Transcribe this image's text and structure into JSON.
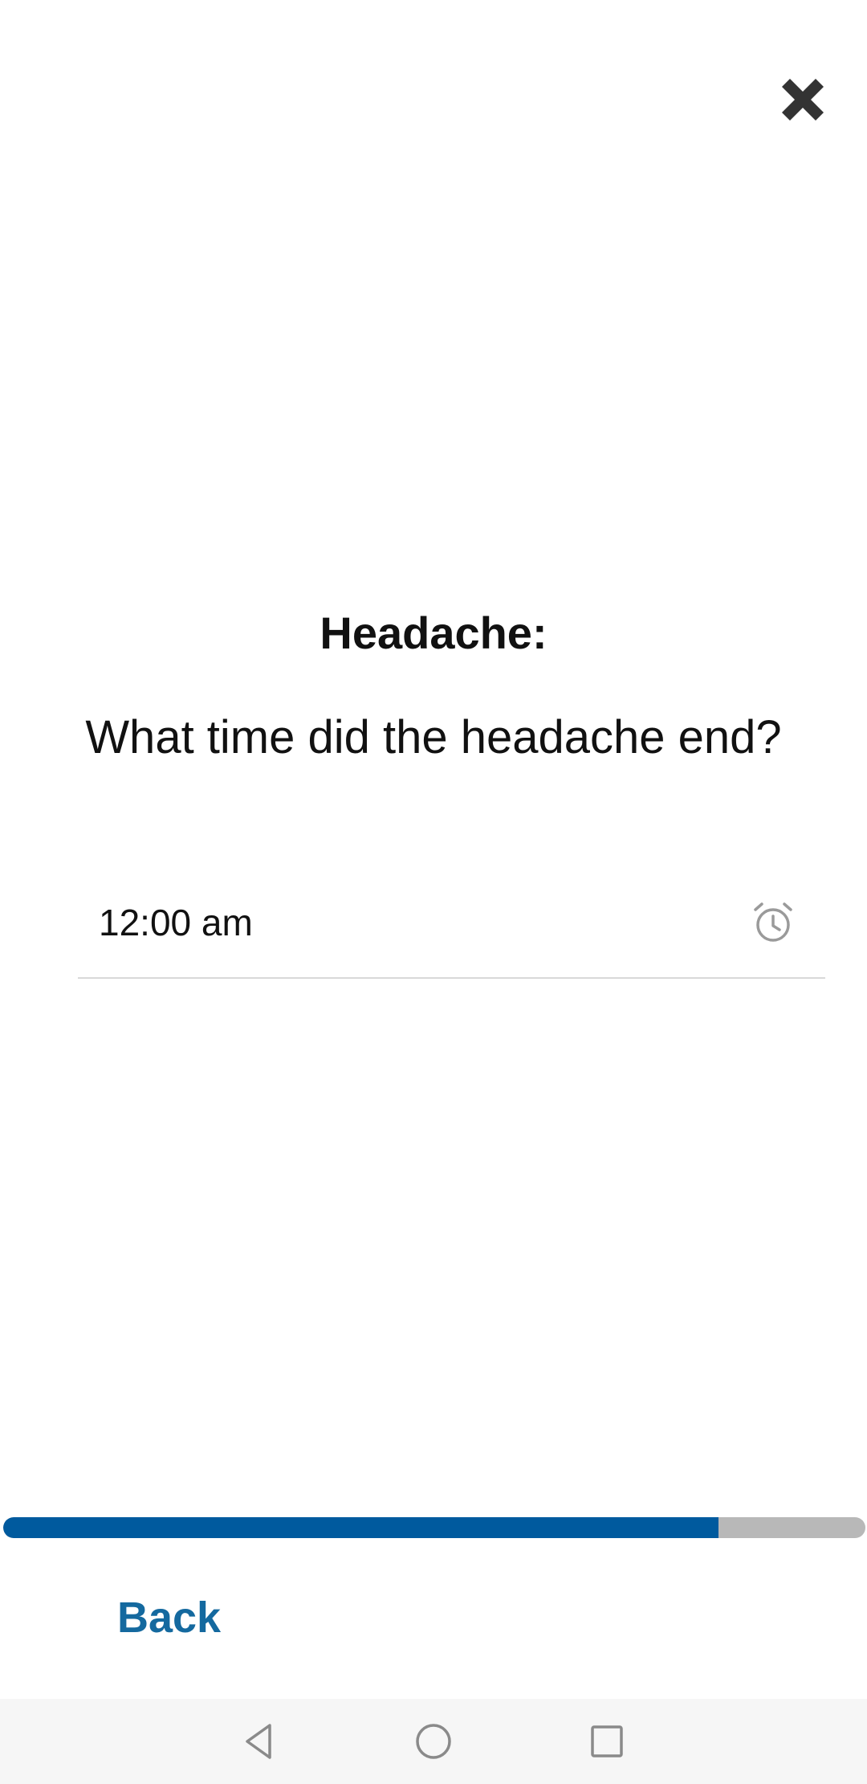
{
  "header": {
    "close_icon": "close-icon"
  },
  "question": {
    "title": "Headache:",
    "text": "What time did the headache end?"
  },
  "time_field": {
    "value": "12:00 am",
    "icon": "alarm-clock-icon"
  },
  "progress": {
    "fraction": 0.83,
    "fill_color": "#005a9e",
    "track_color": "#b8b8b8"
  },
  "footer": {
    "back_label": "Back",
    "back_color": "#14699f"
  },
  "system_nav": {
    "back_icon": "nav-back-triangle-icon",
    "home_icon": "nav-home-circle-icon",
    "recents_icon": "nav-recents-square-icon"
  }
}
